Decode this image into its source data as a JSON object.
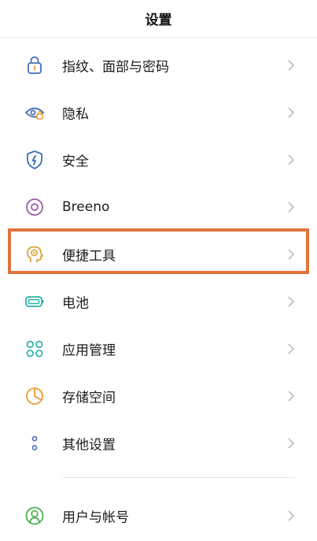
{
  "header": {
    "title": "设置"
  },
  "items": [
    {
      "label": "指纹、面部与密码",
      "icon": "lock-icon",
      "color": "#4a6fb5"
    },
    {
      "label": "隐私",
      "icon": "eye-lock-icon",
      "color": "#4a6fb5"
    },
    {
      "label": "安全",
      "icon": "shield-icon",
      "color": "#3d6fb6"
    },
    {
      "label": "Breeno",
      "icon": "breeno-icon",
      "color": "#9a5fa8"
    },
    {
      "label": "便捷工具",
      "icon": "head-gear-icon",
      "color": "#d9a33a"
    },
    {
      "label": "电池",
      "icon": "battery-icon",
      "color": "#2bb3a8"
    },
    {
      "label": "应用管理",
      "icon": "apps-icon",
      "color": "#2bb3a8"
    },
    {
      "label": "存储空间",
      "icon": "storage-pie-icon",
      "color": "#e9a13b"
    },
    {
      "label": "其他设置",
      "icon": "more-dots-icon",
      "color": "#4a6fb5"
    }
  ],
  "account": {
    "label": "用户与帐号",
    "icon": "user-icon",
    "color": "#4caf50"
  },
  "colors": {
    "highlight": "#e0733e",
    "chevron": "#bdbdbd"
  }
}
